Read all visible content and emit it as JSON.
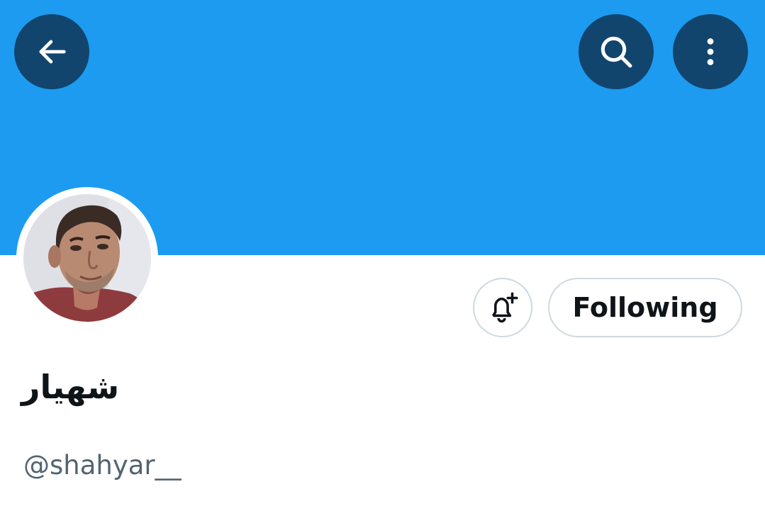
{
  "header": {
    "banner_color": "#1d9bf0",
    "back_icon": "arrow-left-icon",
    "search_icon": "search-icon",
    "more_icon": "more-vertical-icon"
  },
  "profile": {
    "avatar": "profile-photo",
    "display_name": "شهیار",
    "handle": "@shahyar__",
    "notify_icon": "bell-plus-icon",
    "follow_button_label": "Following"
  }
}
